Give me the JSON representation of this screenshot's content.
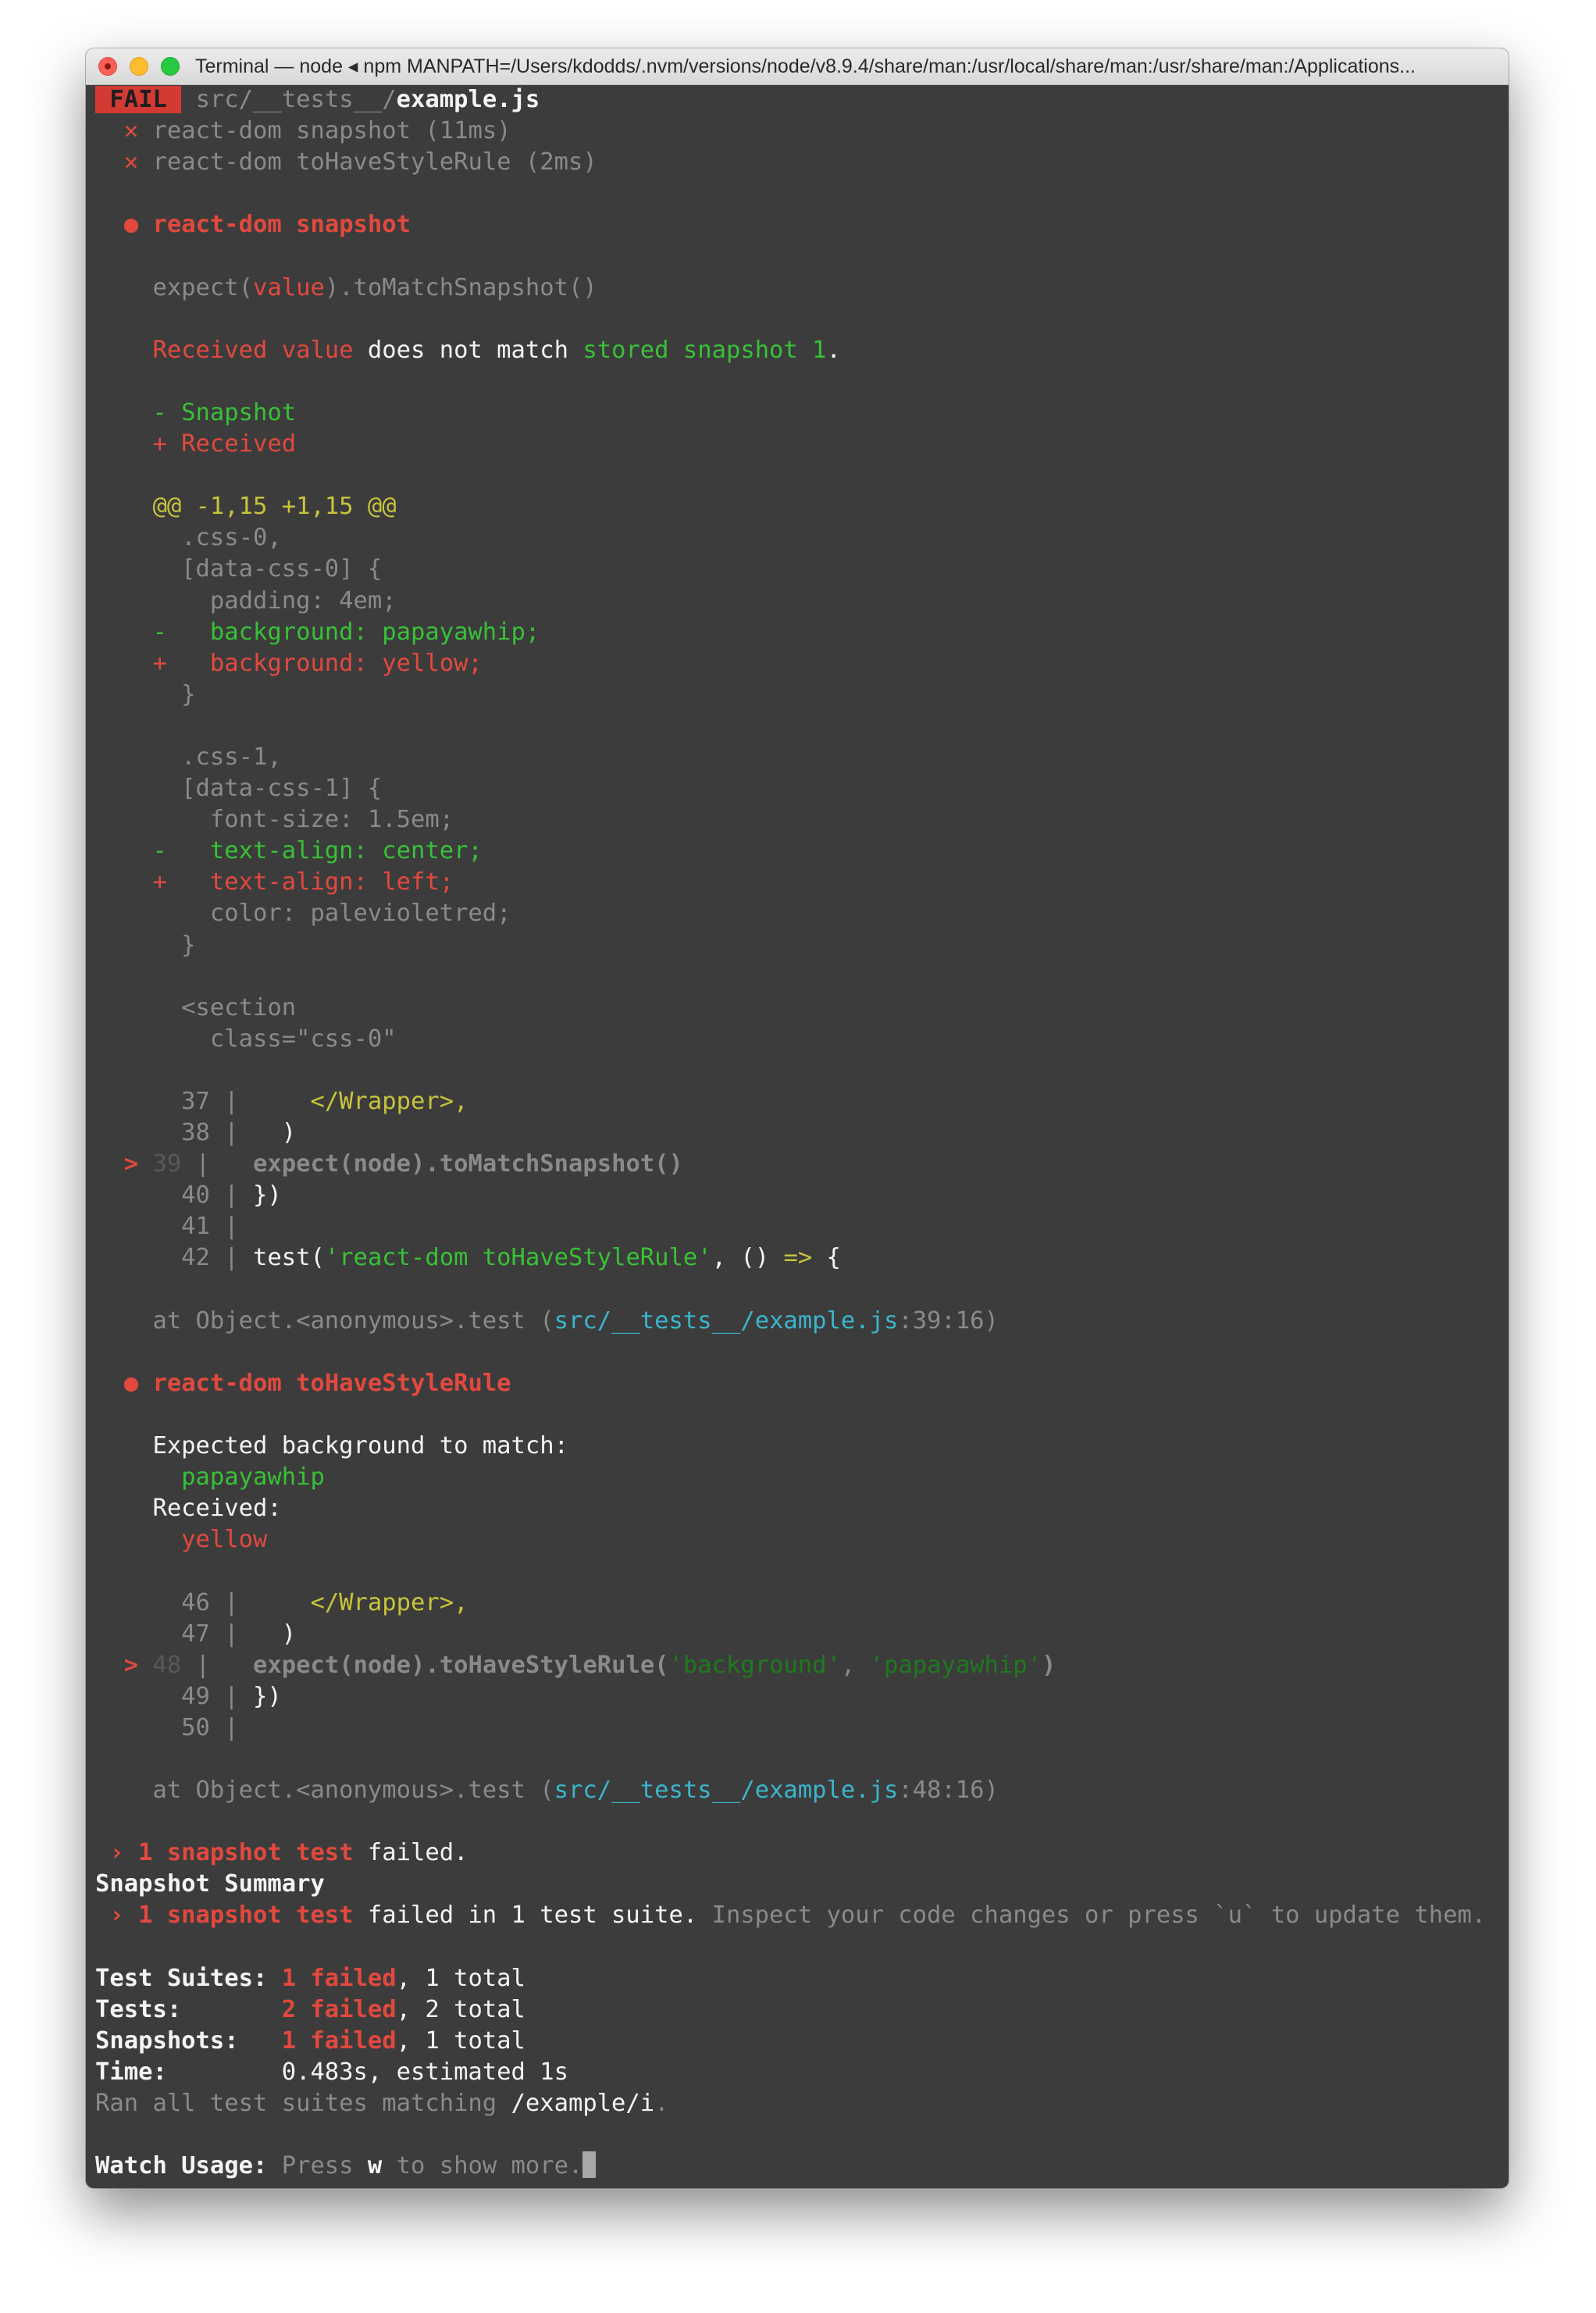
{
  "window": {
    "title": "Terminal — node ◂ npm MANPATH=/Users/kdodds/.nvm/versions/node/v8.9.4/share/man:/usr/local/share/man:/usr/share/man:/Applications..."
  },
  "run": {
    "status": "FAIL",
    "file_dir": "src/__tests__/",
    "file_name": "example.js",
    "tests": [
      {
        "mark": "✕",
        "label": "react-dom snapshot (11ms)"
      },
      {
        "mark": "✕",
        "label": "react-dom toHaveStyleRule (2ms)"
      }
    ]
  },
  "failure1": {
    "bullet": "●",
    "name": "react-dom snapshot",
    "expect_line": {
      "a": "expect(",
      "b": "value",
      "c": ").toMatchSnapshot()"
    },
    "received_line": {
      "a": "Received value",
      "b": " does not match ",
      "c": "stored snapshot 1",
      "d": "."
    },
    "legend_snapshot": "- Snapshot",
    "legend_received": "+ Received",
    "hunk": "@@ -1,15 +1,15 @@",
    "diff": [
      {
        "kind": "dim",
        "text": "  .css-0,"
      },
      {
        "kind": "dim",
        "text": "  [data-css-0] {"
      },
      {
        "kind": "dim",
        "text": "    padding: 4em;"
      },
      {
        "kind": "green",
        "text": "-   background: papayawhip;"
      },
      {
        "kind": "red",
        "text": "+   background: yellow;"
      },
      {
        "kind": "dim",
        "text": "  }"
      },
      {
        "kind": "blank",
        "text": ""
      },
      {
        "kind": "dim",
        "text": "  .css-1,"
      },
      {
        "kind": "dim",
        "text": "  [data-css-1] {"
      },
      {
        "kind": "dim",
        "text": "    font-size: 1.5em;"
      },
      {
        "kind": "green",
        "text": "-   text-align: center;"
      },
      {
        "kind": "red",
        "text": "+   text-align: left;"
      },
      {
        "kind": "dim",
        "text": "    color: palevioletred;"
      },
      {
        "kind": "dim",
        "text": "  }"
      },
      {
        "kind": "blank",
        "text": ""
      },
      {
        "kind": "dim",
        "text": "  <section"
      },
      {
        "kind": "dim",
        "text": "    class=\"css-0\""
      }
    ],
    "code": {
      "l37_num": "  37 |     ",
      "l37_code": "</Wrapper>,",
      "l38_num": "  38 |   ",
      "l38_code": ")",
      "l39_mark": "> ",
      "l39_num": "39",
      "l39_sep": " |   ",
      "l39_code": "expect(node).toMatchSnapshot()",
      "l40_num": "  40 | ",
      "l40_code": "})",
      "l41_num": "  41 |",
      "l42_num": "  42 | ",
      "l42_a": "test(",
      "l42_b": "'react-dom toHaveStyleRule'",
      "l42_c": ", () ",
      "l42_d": "=>",
      "l42_e": " {"
    },
    "stack": {
      "a": "  at Object.<anonymous>.test (",
      "b": "src/__tests__/example.js",
      "c": ":39:16)"
    }
  },
  "failure2": {
    "bullet": "●",
    "name": "react-dom toHaveStyleRule",
    "expected_label": "Expected background to match:",
    "expected_value": "  papayawhip",
    "received_label": "Received:",
    "received_value": "  yellow",
    "code": {
      "l46_num": "  46 |     ",
      "l46_code": "</Wrapper>,",
      "l47_num": "  47 |   ",
      "l47_code": ")",
      "l48_mark": "> ",
      "l48_num": "48",
      "l48_sep": " |   ",
      "l48_a": "expect(node).toHaveStyleRule(",
      "l48_b": "'background'",
      "l48_c": ", ",
      "l48_d": "'papayawhip'",
      "l48_e": ")",
      "l49_num": "  49 | ",
      "l49_code": "})",
      "l50_num": "  50 |"
    },
    "stack": {
      "a": "  at Object.<anonymous>.test (",
      "b": "src/__tests__/example.js",
      "c": ":48:16)"
    }
  },
  "summary": {
    "failed_line": {
      "a": " › 1 snapshot test",
      "b": " failed."
    },
    "heading": "Snapshot Summary",
    "suite_line": {
      "a": " › 1 snapshot test",
      "b": " failed in 1 test suite.",
      "c": " Inspect your code changes or press `u` to update them."
    },
    "stats": [
      {
        "label": "Test Suites: ",
        "failed": "1 failed",
        "rest": ", 1 total"
      },
      {
        "label": "Tests:       ",
        "failed": "2 failed",
        "rest": ", 2 total"
      },
      {
        "label": "Snapshots:   ",
        "failed": "1 failed",
        "rest": ", 1 total"
      }
    ],
    "time_label": "Time:        ",
    "time_value": "0.483s, estimated 1s",
    "ran_a": "Ran all test suites matching ",
    "ran_b": "/example/i",
    "ran_c": "."
  },
  "watch": {
    "label": "Watch Usage:",
    "a": " Press ",
    "key": "w",
    "b": " to show more."
  }
}
